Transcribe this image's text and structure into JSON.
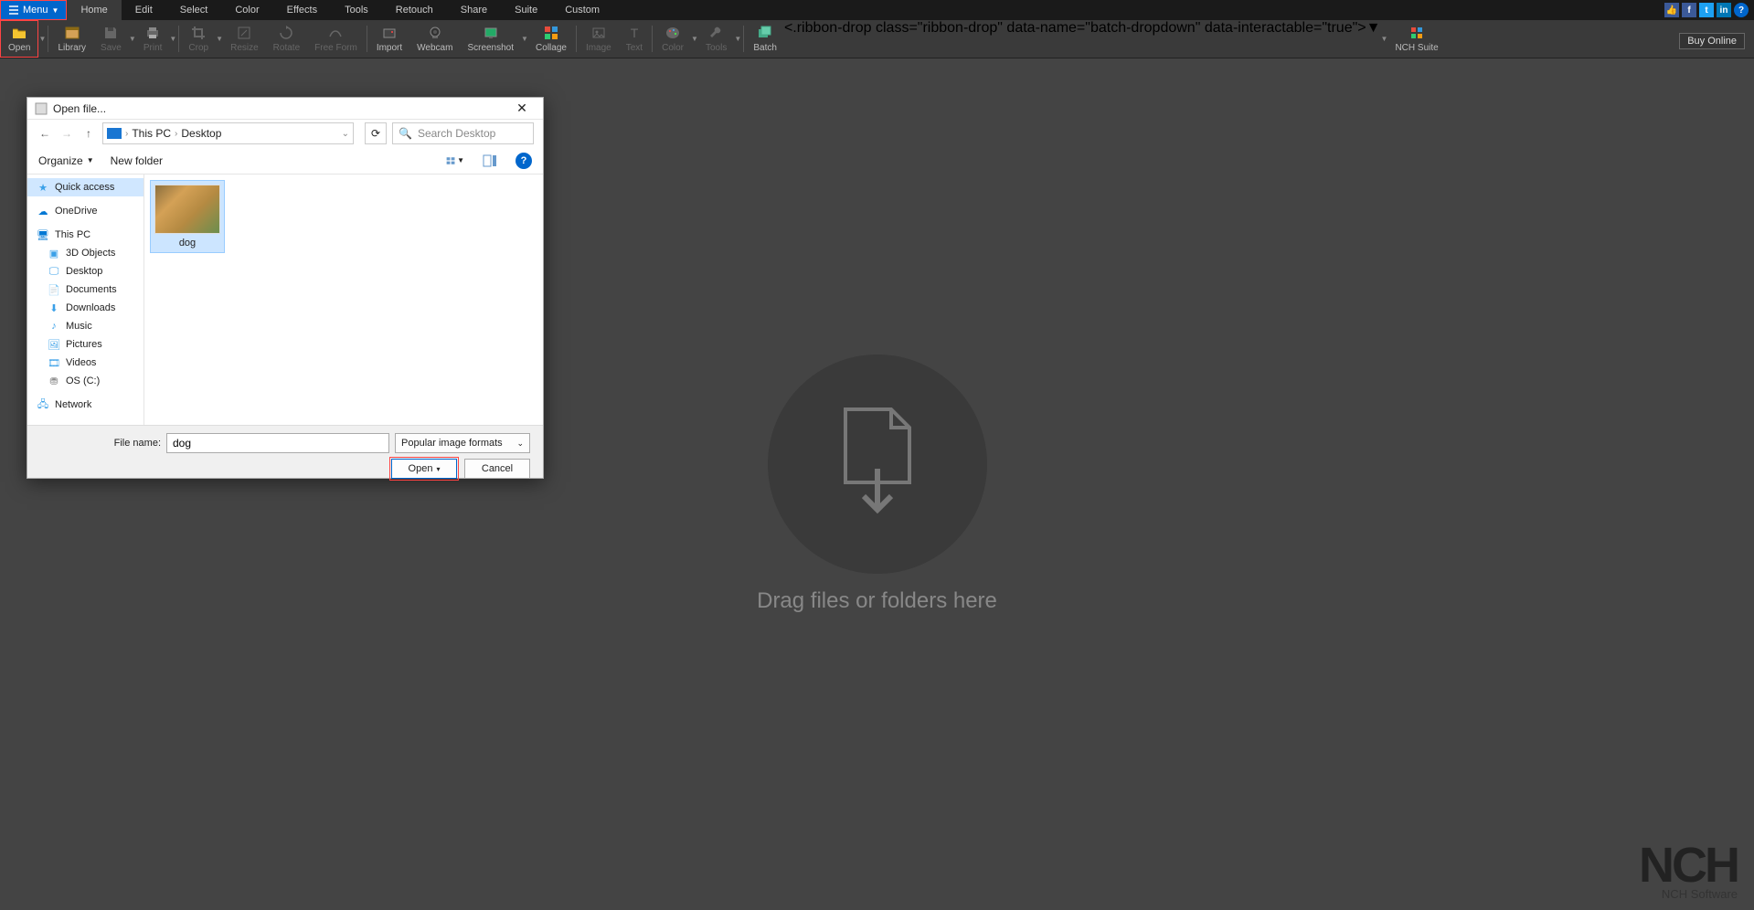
{
  "menu": {
    "button": "Menu",
    "tabs": [
      "Home",
      "Edit",
      "Select",
      "Color",
      "Effects",
      "Tools",
      "Retouch",
      "Share",
      "Suite",
      "Custom"
    ]
  },
  "ribbon": {
    "open": "Open",
    "library": "Library",
    "save": "Save",
    "print": "Print",
    "crop": "Crop",
    "resize": "Resize",
    "rotate": "Rotate",
    "freeform": "Free Form",
    "import": "Import",
    "webcam": "Webcam",
    "screenshot": "Screenshot",
    "collage": "Collage",
    "image": "Image",
    "text": "Text",
    "color": "Color",
    "tools": "Tools",
    "batch": "Batch",
    "nchsuite": "NCH Suite",
    "buy": "Buy Online"
  },
  "canvas": {
    "droptext": "Drag files or folders here"
  },
  "watermark": {
    "brand": "NCH",
    "sub": "NCH Software"
  },
  "dialog": {
    "title": "Open file...",
    "breadcrumb": {
      "pc": "This PC",
      "loc": "Desktop"
    },
    "refresh": "⟳",
    "search_placeholder": "Search Desktop",
    "organize": "Organize",
    "newfolder": "New folder",
    "sidebar": {
      "quick": "Quick access",
      "onedrive": "OneDrive",
      "thispc": "This PC",
      "objects3d": "3D Objects",
      "desktop": "Desktop",
      "documents": "Documents",
      "downloads": "Downloads",
      "music": "Music",
      "pictures": "Pictures",
      "videos": "Videos",
      "osc": "OS (C:)",
      "network": "Network"
    },
    "file": {
      "name": "dog"
    },
    "footer": {
      "filename_label": "File name:",
      "filename_value": "dog",
      "filetype": "Popular image formats",
      "open": "Open",
      "cancel": "Cancel"
    }
  }
}
